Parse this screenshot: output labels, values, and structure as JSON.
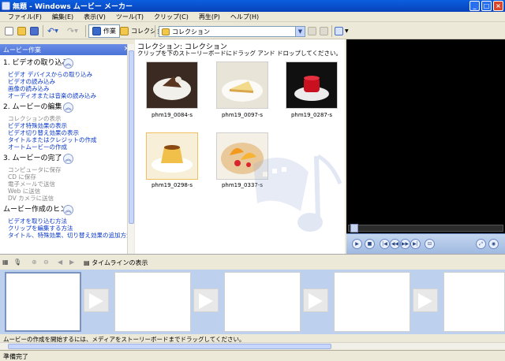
{
  "window": {
    "title": "無題 - Windows ムービー メーカー"
  },
  "menu": [
    "ファイル(F)",
    "編集(E)",
    "表示(V)",
    "ツール(T)",
    "クリップ(C)",
    "再生(P)",
    "ヘルプ(H)"
  ],
  "toolbar": {
    "tasks_label": "作業",
    "collections_label": "コレクション",
    "combo_value": "コレクション"
  },
  "tasks_pane": {
    "header": "ムービー作業",
    "sections": [
      {
        "title": "1. ビデオの取り込み",
        "links": [
          {
            "label": "ビデオ デバイスからの取り込み",
            "enabled": true
          },
          {
            "label": "ビデオの読み込み",
            "enabled": true
          },
          {
            "label": "画像の読み込み",
            "enabled": true
          },
          {
            "label": "オーディオまたは音楽の読み込み",
            "enabled": true
          }
        ]
      },
      {
        "title": "2. ムービーの編集",
        "links": [
          {
            "label": "コレクションの表示",
            "enabled": false
          },
          {
            "label": "ビデオ特殊効果の表示",
            "enabled": true
          },
          {
            "label": "ビデオ切り替え効果の表示",
            "enabled": true
          },
          {
            "label": "タイトルまたはクレジットの作成",
            "enabled": true
          },
          {
            "label": "オートムービーの作成",
            "enabled": true
          }
        ]
      },
      {
        "title": "3. ムービーの完了",
        "links": [
          {
            "label": "コンピュータに保存",
            "enabled": false
          },
          {
            "label": "CD に保存",
            "enabled": false
          },
          {
            "label": "電子メールで送信",
            "enabled": false
          },
          {
            "label": "Web に送信",
            "enabled": false
          },
          {
            "label": "DV カメラに送信",
            "enabled": false
          }
        ]
      },
      {
        "title": "ムービー作成のヒント",
        "links": [
          {
            "label": "ビデオを取り込む方法",
            "enabled": true
          },
          {
            "label": "クリップを編集する方法",
            "enabled": true
          },
          {
            "label": "タイトル、特殊効果、切り替え効果の追加方法",
            "enabled": true
          }
        ]
      }
    ]
  },
  "collection": {
    "title": "コレクション: コレクション",
    "subtitle": "クリップを下のストーリーボードにドラッグ アンド ドロップしてください。",
    "clips": [
      {
        "name": "phm19_0084-s",
        "thumb": "chocolate-cake"
      },
      {
        "name": "phm19_0097-s",
        "thumb": "cheesecake"
      },
      {
        "name": "phm19_0287-s",
        "thumb": "panna-cotta"
      },
      {
        "name": "phm19_0298-s",
        "thumb": "pudding",
        "selected": true
      },
      {
        "name": "phm19_0337-s",
        "thumb": "fruit-tart"
      }
    ]
  },
  "storyboard": {
    "timeline_label": "タイムラインの表示",
    "hint": "ムービーの作成を開始するには、メディアをストーリーボードまでドラッグしてください。"
  },
  "status": "準備完了"
}
